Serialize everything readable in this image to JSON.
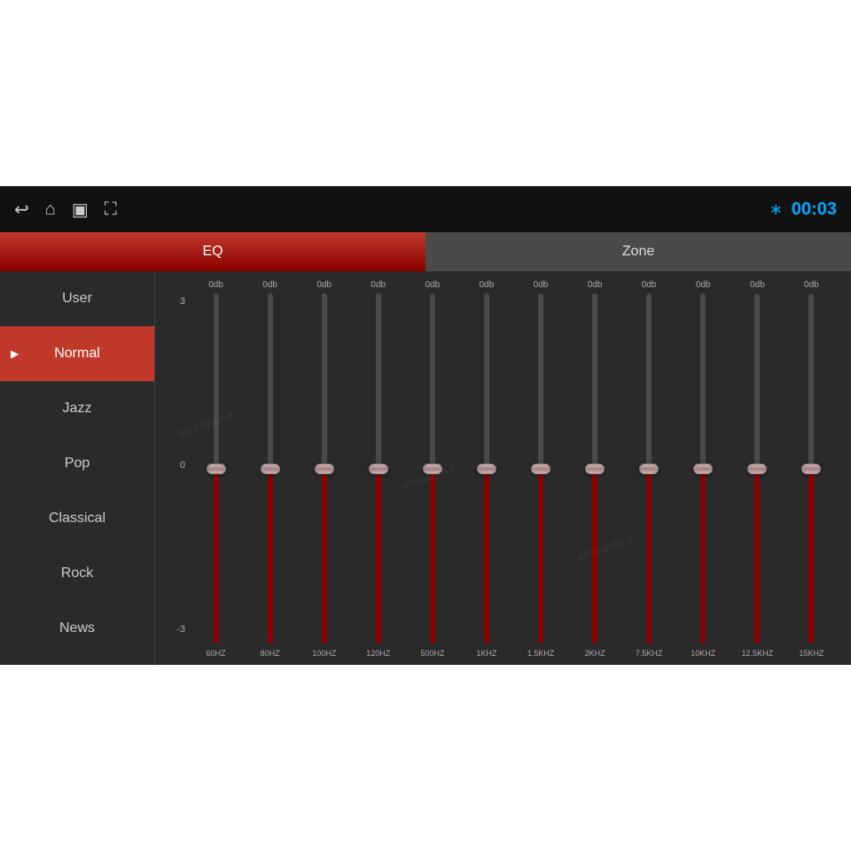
{
  "topbar": {
    "time": "00:03",
    "icons": [
      "back",
      "home",
      "window",
      "image"
    ]
  },
  "tabs": {
    "eq_label": "EQ",
    "zone_label": "Zone"
  },
  "sidebar": {
    "items": [
      {
        "id": "user",
        "label": "User",
        "active": false
      },
      {
        "id": "normal",
        "label": "Normal",
        "active": true
      },
      {
        "id": "jazz",
        "label": "Jazz",
        "active": false
      },
      {
        "id": "pop",
        "label": "Pop",
        "active": false
      },
      {
        "id": "classical",
        "label": "Classical",
        "active": false
      },
      {
        "id": "rock",
        "label": "Rock",
        "active": false
      },
      {
        "id": "news",
        "label": "News",
        "active": false
      }
    ]
  },
  "eq": {
    "scale": {
      "top": "3",
      "mid": "0",
      "bot": "-3"
    },
    "bands": [
      {
        "freq": "60HZ",
        "db": "0db",
        "value": 0
      },
      {
        "freq": "80HZ",
        "db": "0db",
        "value": 0
      },
      {
        "freq": "100HZ",
        "db": "0db",
        "value": 0
      },
      {
        "freq": "120HZ",
        "db": "0db",
        "value": 0
      },
      {
        "freq": "500HZ",
        "db": "0db",
        "value": 0
      },
      {
        "freq": "1KHZ",
        "db": "0db",
        "value": 0
      },
      {
        "freq": "1.5KHZ",
        "db": "0db",
        "value": 0
      },
      {
        "freq": "2KHZ",
        "db": "0db",
        "value": 0
      },
      {
        "freq": "7.5KHZ",
        "db": "0db",
        "value": 0
      },
      {
        "freq": "10KHZ",
        "db": "0db",
        "value": 0
      },
      {
        "freq": "12.5KHZ",
        "db": "0db",
        "value": 0
      },
      {
        "freq": "15KHZ",
        "db": "0db",
        "value": 0
      }
    ]
  }
}
